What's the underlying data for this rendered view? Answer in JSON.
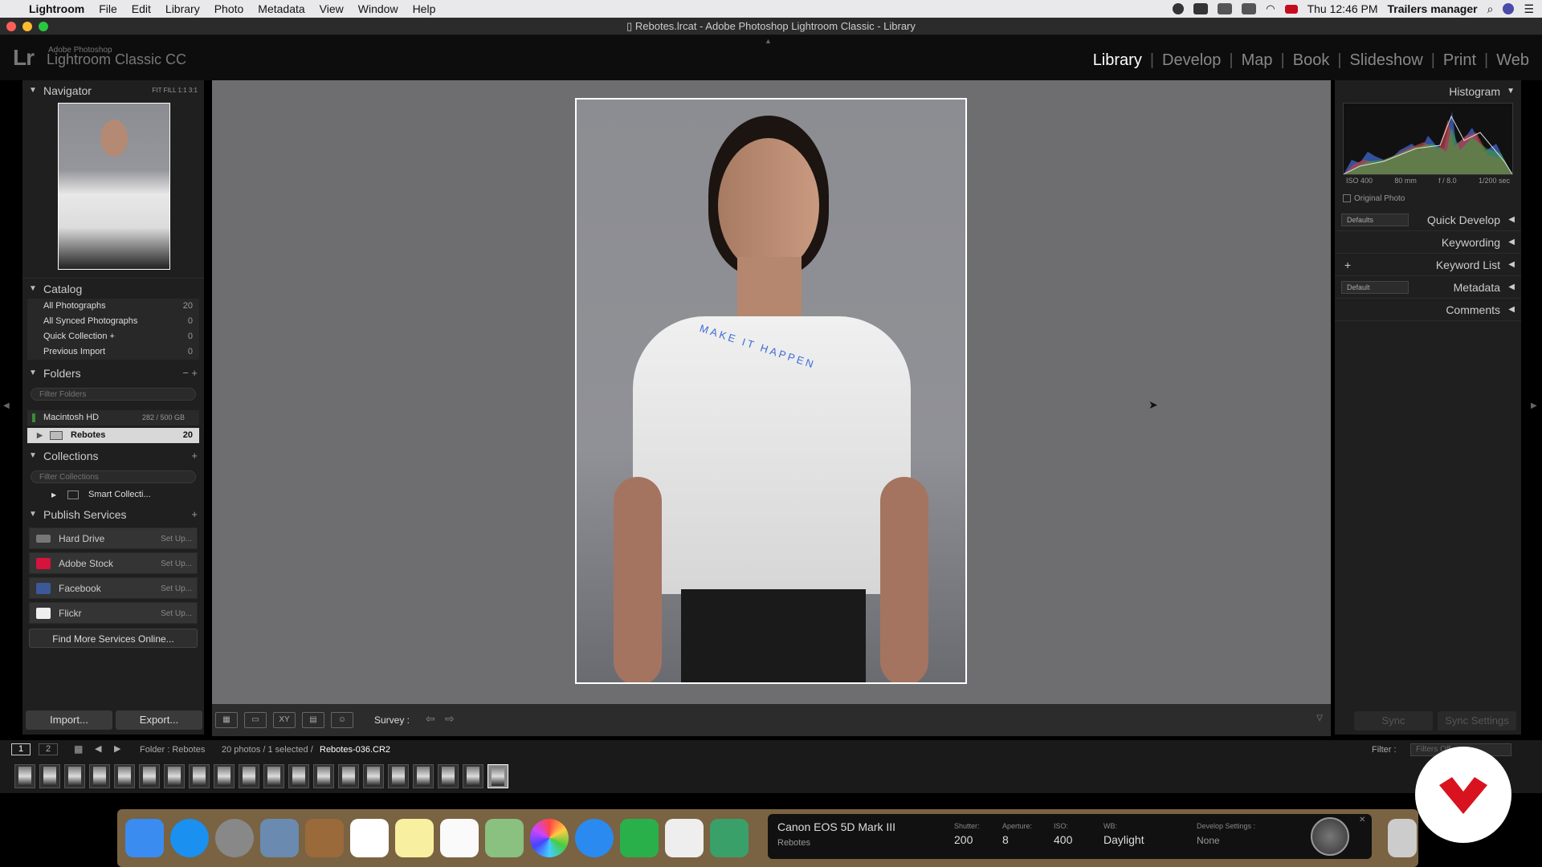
{
  "menubar": {
    "app": "Lightroom",
    "items": [
      "File",
      "Edit",
      "Library",
      "Photo",
      "Metadata",
      "View",
      "Window",
      "Help"
    ],
    "clock": "Thu 12:46 PM",
    "user": "Trailers manager"
  },
  "window": {
    "title": "Rebotes.lrcat - Adobe Photoshop Lightroom Classic - Library"
  },
  "identity": {
    "logo": "Lr",
    "small": "Adobe Photoshop",
    "name": "Lightroom Classic CC"
  },
  "modules": [
    "Library",
    "Develop",
    "Map",
    "Book",
    "Slideshow",
    "Print",
    "Web"
  ],
  "left": {
    "navigator": {
      "title": "Navigator",
      "zoom": "FIT   FILL   1:1   3:1"
    },
    "catalog": {
      "title": "Catalog",
      "items": [
        {
          "label": "All Photographs",
          "count": "20"
        },
        {
          "label": "All Synced Photographs",
          "count": "0"
        },
        {
          "label": "Quick Collection  +",
          "count": "0"
        },
        {
          "label": "Previous Import",
          "count": "0"
        }
      ]
    },
    "folders": {
      "title": "Folders",
      "actions": "−  +",
      "filter_placeholder": "Filter Folders",
      "volume": "Macintosh HD",
      "volume_size": "282 / 500 GB",
      "folder": "Rebotes",
      "folder_count": "20"
    },
    "collections": {
      "title": "Collections",
      "action": "+",
      "filter_placeholder": "Filter Collections",
      "item": "Smart Collecti..."
    },
    "publish": {
      "title": "Publish Services",
      "action": "+",
      "services": [
        {
          "label": "Hard Drive",
          "setup": "Set Up..."
        },
        {
          "label": "Adobe Stock",
          "setup": "Set Up..."
        },
        {
          "label": "Facebook",
          "setup": "Set Up..."
        },
        {
          "label": "Flickr",
          "setup": "Set Up..."
        }
      ],
      "find_more": "Find More Services Online..."
    },
    "import": "Import...",
    "export": "Export..."
  },
  "toolbar": {
    "survey": "Survey :"
  },
  "right": {
    "histogram": {
      "title": "Histogram",
      "iso": "ISO 400",
      "focal": "80 mm",
      "aperture": "f / 8.0",
      "shutter": "1/200 sec",
      "original": "Original Photo"
    },
    "quick_develop": {
      "title": "Quick Develop",
      "preset": "Defaults"
    },
    "keywording": "Keywording",
    "keyword_list": "Keyword List",
    "metadata": {
      "title": "Metadata",
      "preset": "Default"
    },
    "comments": "Comments",
    "sync": "Sync",
    "sync_settings": "Sync Settings"
  },
  "filmstrip": {
    "pages": [
      "1",
      "2"
    ],
    "folder": "Folder : Rebotes",
    "count": "20 photos / 1 selected /",
    "selected_file": "Rebotes-036.CR2",
    "filter": "Filter :",
    "filter_value": "Filters Off",
    "thumbs": 20,
    "selected_index": 19
  },
  "camera_hud": {
    "model": "Canon EOS 5D Mark III",
    "folder": "Rebotes",
    "shutter_label": "Shutter:",
    "shutter": "200",
    "aperture_label": "Aperture:",
    "aperture": "8",
    "iso_label": "ISO:",
    "iso": "400",
    "wb_label": "WB:",
    "wb": "Daylight",
    "dev_label": "Develop Settings :",
    "dev": "None"
  },
  "photo_text": "MAKE IT HAPPEN",
  "colors": {
    "accent_active": "#ffffff",
    "panel": "#1f1f1f",
    "canvas": "#6e6e70",
    "stock_red": "#d6133c",
    "fb_blue": "#3b5998"
  }
}
